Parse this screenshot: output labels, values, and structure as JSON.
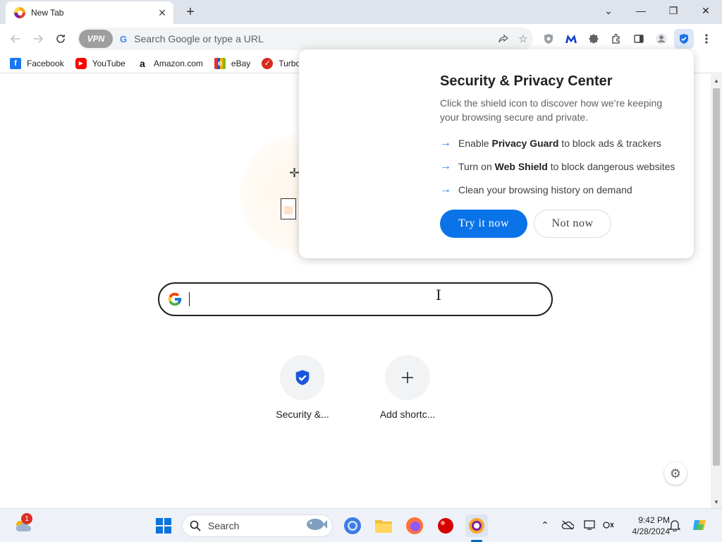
{
  "tab": {
    "title": "New Tab",
    "close": "✕",
    "new_tab": "+"
  },
  "window_controls": {
    "dropdown": "⌄",
    "minimize": "—",
    "restore": "❐",
    "close": "✕"
  },
  "toolbar": {
    "vpn_label": "VPN",
    "omnibox_placeholder": "Search Google or type a URL",
    "icons": [
      "back-arrow-icon",
      "forward-arrow-icon",
      "reload-icon",
      "share-icon",
      "star-icon",
      "shield-extension-icon",
      "malwarebytes-icon",
      "extension-badge-icon",
      "puzzle-icon",
      "sidepanel-icon",
      "profile-icon",
      "security-shield-icon",
      "menu-icon"
    ]
  },
  "bookmarks": [
    {
      "label": "Facebook",
      "icon": "facebook-icon",
      "color": "#1877f2",
      "glyph": "f"
    },
    {
      "label": "YouTube",
      "icon": "youtube-icon",
      "color": "#ff0000",
      "glyph": "▶"
    },
    {
      "label": "Amazon.com",
      "icon": "amazon-icon",
      "color": "#ffffff",
      "glyph": "a"
    },
    {
      "label": "eBay",
      "icon": "ebay-icon",
      "color": "#ffffff",
      "glyph": "e"
    },
    {
      "label": "TurboT",
      "icon": "turbotax-icon",
      "color": "#d52b1e",
      "glyph": "✓"
    }
  ],
  "popup": {
    "title": "Security & Privacy Center",
    "description": "Click the shield icon to discover how we’re keeping your browsing secure and private.",
    "items": [
      {
        "pre": "Enable ",
        "bold": "Privacy Guard",
        "post": " to block ads & trackers"
      },
      {
        "pre": "Turn on ",
        "bold": "Web Shield",
        "post": " to block dangerous websites"
      },
      {
        "pre": "Clean your browsing history on demand",
        "bold": "",
        "post": ""
      }
    ],
    "primary_button": "Try it now",
    "secondary_button": "Not now",
    "accent_color": "#0b73e8"
  },
  "shortcuts": [
    {
      "label": "Security &...",
      "icon": "shield-check-icon"
    },
    {
      "label": "Add shortc...",
      "icon": "plus-icon"
    }
  ],
  "taskbar": {
    "search_label": "Search",
    "weather_badge": "1",
    "time": "9:42 PM",
    "date": "4/28/2024"
  }
}
